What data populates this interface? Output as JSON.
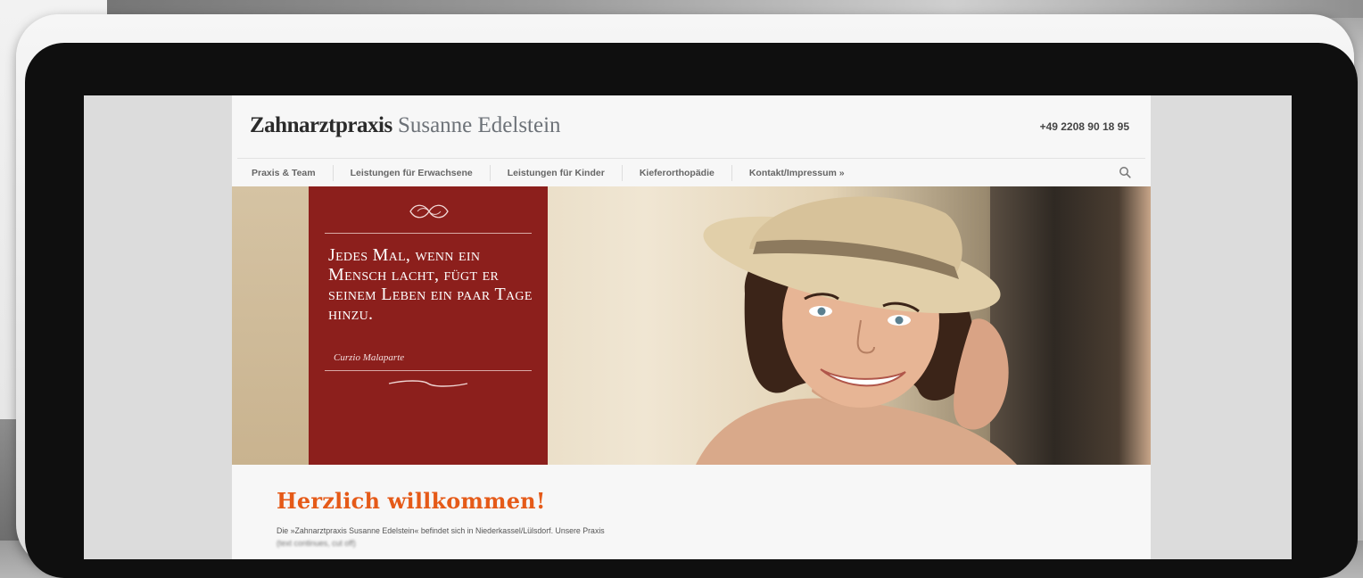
{
  "site": {
    "brand_bold": "Zahnarztpraxis",
    "brand_light": "Susanne Edelstein",
    "phone": "+49 2208 90 18 95"
  },
  "nav": {
    "items": [
      {
        "label": "Praxis & Team"
      },
      {
        "label": "Leistungen für Erwachsene"
      },
      {
        "label": "Leistungen für Kinder"
      },
      {
        "label": "Kieferorthopädie"
      },
      {
        "label": "Kontakt/Impressum »"
      }
    ],
    "search_icon": "search-icon"
  },
  "hero": {
    "quote": "Jedes Mal, wenn ein Mensch lacht, fügt er seinem Leben ein paar Tage hinzu.",
    "author": "Curzio Malaparte",
    "quote_bg": "#8c1f1c"
  },
  "main": {
    "heading": "Herzlich willkommen!",
    "intro_line1": "Die »Zahnarztpraxis Susanne Edelstein« befindet sich in Niederkassel/Lülsdorf. Unsere Praxis",
    "intro_line2": "(text continues, cut off)",
    "accent": "#e55a18"
  }
}
